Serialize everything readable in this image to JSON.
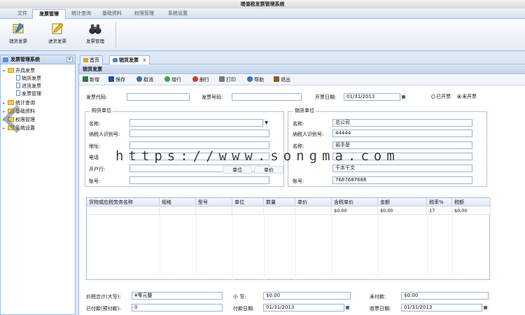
{
  "window": {
    "title": "增值税发票管理系统"
  },
  "menu": {
    "items": [
      "文件",
      "发票管理",
      "统计查询",
      "基础资料",
      "权限管理",
      "系统设置"
    ],
    "active": 1
  },
  "ribbon": {
    "buttons": [
      {
        "label": "销货发票",
        "icon": "sales-invoice-icon"
      },
      {
        "label": "进货发票",
        "icon": "purchase-invoice-icon"
      },
      {
        "label": "发票管理",
        "icon": "binoculars-icon"
      }
    ]
  },
  "sidebar": {
    "title": "发票管理系统",
    "collapse_label": "«",
    "tree": [
      {
        "label": "开具发票",
        "type": "folder",
        "expanded": true
      },
      {
        "label": "销货发票",
        "type": "doc"
      },
      {
        "label": "进货发票",
        "type": "doc"
      },
      {
        "label": "发票管理",
        "type": "doc"
      },
      {
        "label": "统计查询",
        "type": "folder"
      },
      {
        "label": "基础资料",
        "type": "folder"
      },
      {
        "label": "权限管理",
        "type": "folder"
      },
      {
        "label": "系统设置",
        "type": "folder"
      }
    ]
  },
  "tabs": [
    {
      "label": "首页"
    },
    {
      "label": "销货发票",
      "close": "×"
    }
  ],
  "panel": {
    "title": "销货发票"
  },
  "toolbar": {
    "buttons": [
      {
        "label": "新增",
        "color": "#2e7d32"
      },
      {
        "label": "保存",
        "color": "#1e4fa3"
      },
      {
        "label": "取消",
        "color": "#3d6db5"
      },
      {
        "label": "增行",
        "color": "#3aa34a"
      },
      {
        "label": "删行",
        "color": "#d93a2b"
      },
      {
        "label": "打印",
        "color": "#6d7b8f"
      },
      {
        "label": "帮助",
        "color": "#2f6fd0"
      },
      {
        "label": "退出",
        "color": "#8a5a2b"
      }
    ]
  },
  "header": {
    "invoice_code_label": "发票代码:",
    "invoice_code": "",
    "invoice_no_label": "发票号码:",
    "invoice_no": "",
    "date_label": "开票日期:",
    "date": "01/31/2013",
    "radio_issued": "已开票",
    "radio_not_issued": "未开票"
  },
  "buyer": {
    "legend": "购货单位",
    "name_label": "名称:",
    "name": "",
    "tax_id_label": "纳税人识别号:",
    "tax_id": "",
    "address_label": "地址:",
    "address": "",
    "phone_label": "电话",
    "phone": "",
    "bank_label": "开户行:",
    "bank": "",
    "account_label": "账号:",
    "account": ""
  },
  "seller": {
    "legend": "销货单位",
    "name_label": "名称:",
    "name": "总公司",
    "tax_id_label": "纳税人识别号:",
    "tax_id": "44444",
    "address_label": "名称:",
    "address": "岩手是",
    "phone_label": "",
    "phone": "",
    "bank_label": "",
    "bank": "千本千文",
    "account_label": "账号:",
    "account": "7687687686"
  },
  "overlay": {
    "unit": "单位",
    "price": "单价",
    "watermark": "https://www.songma.com"
  },
  "grid": {
    "columns": [
      "货物或应税劳务名称",
      "规格",
      "型号",
      "单位",
      "数量",
      "单价",
      "含税单价",
      "金额",
      "税率%",
      "税额"
    ],
    "rows": [
      [
        "",
        "",
        "",
        "",
        "",
        "",
        "$0.00",
        "$0.00",
        "17",
        "$0.00"
      ]
    ]
  },
  "footer": {
    "total_upper_label": "价税合计(大写):",
    "total_upper": "¥零元整",
    "total_lower_label": "小    写:",
    "total_lower": "$0.00",
    "unpaid_label": "未付款:",
    "unpaid": "$0.00",
    "paid_label": "已付款(预付款):",
    "paid": "0",
    "pay_date_label": "付款日期:",
    "pay_date": "01/31/2013",
    "receipt_date_label": "收票日期:",
    "receipt_date": "01/31/2013"
  }
}
